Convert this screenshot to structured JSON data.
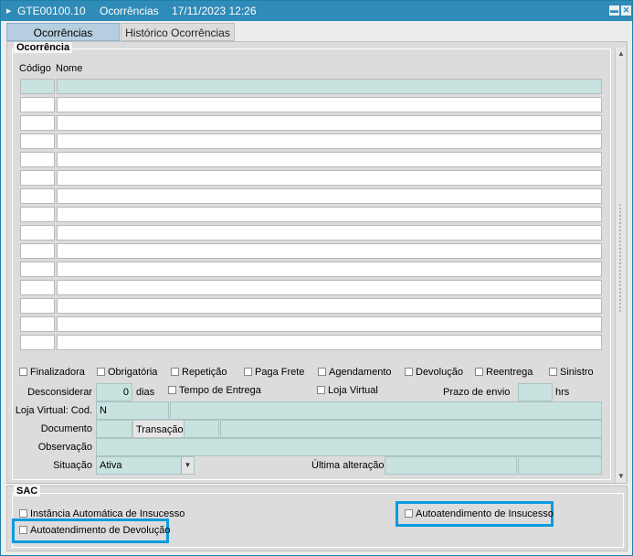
{
  "window": {
    "code": "GTE00100.10",
    "title": "Ocorrências",
    "datetime": "17/11/2023 12:26",
    "minimize_glyph": "▬",
    "close_glyph": "✕"
  },
  "tabs": [
    {
      "label": "Ocorrências",
      "active": true
    },
    {
      "label": "Histórico Ocorrências",
      "active": false
    }
  ],
  "ocorrencia": {
    "section_title": "Ocorrência",
    "columns": {
      "codigo": "Código",
      "nome": "Nome"
    },
    "row_count": 15,
    "flags": [
      {
        "label": "Finalizadora",
        "checked": false
      },
      {
        "label": "Obrigatória",
        "checked": false
      },
      {
        "label": "Repetição",
        "checked": false
      },
      {
        "label": "Paga Frete",
        "checked": false
      },
      {
        "label": "Agendamento",
        "checked": false
      },
      {
        "label": "Devolução",
        "checked": false
      },
      {
        "label": "Reentrega",
        "checked": false
      },
      {
        "label": "Sinistro",
        "checked": false
      }
    ],
    "desconsiderar_label": "Desconsiderar",
    "desconsiderar_value": "0",
    "dias_label": "dias",
    "tempo_entrega_label": "Tempo de Entrega",
    "loja_virtual_label": "Loja Virtual",
    "prazo_envio_label": "Prazo de envio",
    "prazo_envio_value": "",
    "hrs_label": "hrs",
    "loja_virtual_cod_label": "Loja Virtual: Cod.",
    "loja_virtual_cod_value": "N",
    "documento_label": "Documento",
    "transacao_label": "Transação",
    "observacao_label": "Observação",
    "situacao_label": "Situação",
    "situacao_value": "Ativa",
    "ultima_alteracao_label": "Última alteração"
  },
  "sac": {
    "section_title": "SAC",
    "instancia_label": "Instância Automática de Insucesso",
    "auto_insucesso_label": "Autoatendimento de Insucesso",
    "auto_devolucao_label": "Autoatendimento de Devolução"
  },
  "colors": {
    "titlebar": "#2f8bb7",
    "field_teal": "#c8e2e0",
    "highlight": "#0e9bde"
  }
}
